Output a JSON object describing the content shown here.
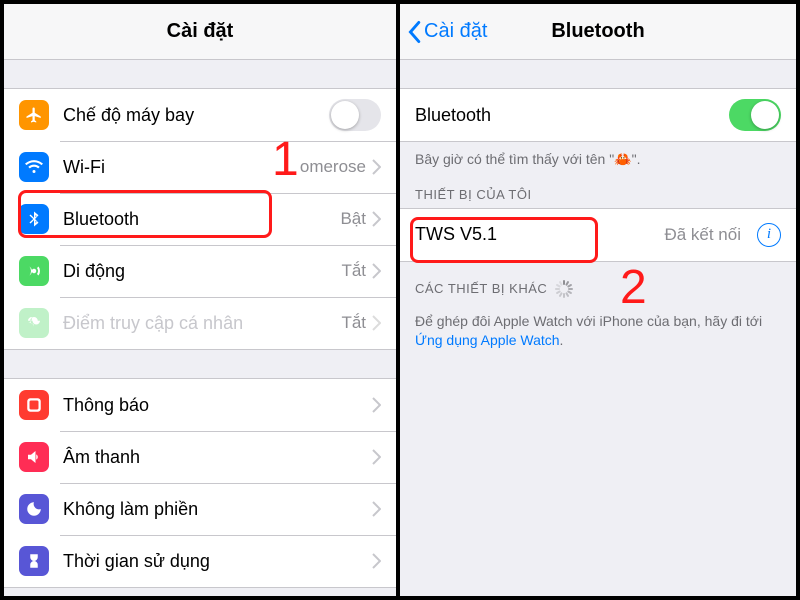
{
  "left": {
    "title": "Cài đặt",
    "group1": [
      {
        "name": "airplane",
        "label": "Chế độ máy bay",
        "switch": false,
        "bg": "bg-orange"
      },
      {
        "name": "wifi",
        "label": "Wi-Fi",
        "value": "omerose",
        "chevron": true,
        "bg": "bg-blue"
      },
      {
        "name": "bluetooth",
        "label": "Bluetooth",
        "value": "Bật",
        "chevron": true,
        "bg": "bg-blue"
      },
      {
        "name": "cellular",
        "label": "Di động",
        "value": "Tắt",
        "chevron": true,
        "bg": "bg-green"
      },
      {
        "name": "hotspot",
        "label": "Điểm truy cập cá nhân",
        "value": "Tắt",
        "chevron": true,
        "bg": "bg-green",
        "disabled": true
      }
    ],
    "group2": [
      {
        "name": "notifications",
        "label": "Thông báo",
        "chevron": true,
        "bg": "bg-red"
      },
      {
        "name": "sounds",
        "label": "Âm thanh",
        "chevron": true,
        "bg": "bg-pink"
      },
      {
        "name": "dnd",
        "label": "Không làm phiền",
        "chevron": true,
        "bg": "bg-purple"
      },
      {
        "name": "screentime",
        "label": "Thời gian sử dụng",
        "chevron": true,
        "bg": "screentime"
      }
    ]
  },
  "right": {
    "back": "Cài đặt",
    "title": "Bluetooth",
    "toggle_label": "Bluetooth",
    "toggle_on": true,
    "discoverable": "Bây giờ có thể tìm thấy với tên \"🦀\".",
    "my_devices_header": "THIẾT BỊ CỦA TÔI",
    "device_name": "TWS V5.1",
    "device_status": "Đã kết nối",
    "other_devices_header": "CÁC THIẾT BỊ KHÁC",
    "pair_note": "Để ghép đôi Apple Watch với iPhone của bạn, hãy đi tới ",
    "pair_link": "Ứng dụng Apple Watch"
  },
  "annotations": {
    "one": "1",
    "two": "2"
  }
}
